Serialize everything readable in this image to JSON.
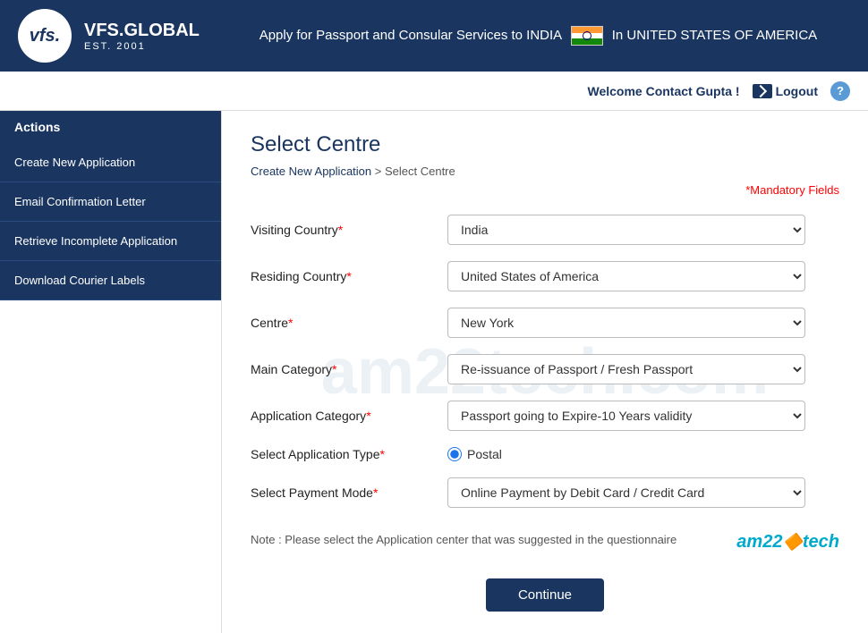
{
  "header": {
    "logo_text": "vfs.",
    "logo_brand": "VFS.GLOBAL",
    "logo_est": "EST. 2001",
    "tagline": "Apply for Passport and Consular Services to INDIA",
    "country": "In UNITED STATES OF AMERICA"
  },
  "topbar": {
    "welcome": "Welcome Contact Gupta !",
    "logout_label": "Logout",
    "help_label": "?"
  },
  "sidebar": {
    "header": "Actions",
    "items": [
      {
        "label": "Create New Application"
      },
      {
        "label": "Email Confirmation Letter"
      },
      {
        "label": "Retrieve Incomplete Application"
      },
      {
        "label": "Download Courier Labels"
      }
    ]
  },
  "page": {
    "title": "Select Centre",
    "breadcrumb_home": "Create New Application",
    "breadcrumb_sep": ">",
    "breadcrumb_current": "Select Centre",
    "mandatory_note": "Mandatory Fields"
  },
  "form": {
    "visiting_country_label": "Visiting Country",
    "visiting_country_value": "India",
    "residing_country_label": "Residing Country",
    "residing_country_value": "United States of America",
    "centre_label": "Centre",
    "centre_value": "New York",
    "main_category_label": "Main Category",
    "main_category_value": "Re-issuance of Passport / Fresh Passport",
    "app_category_label": "Application Category",
    "app_category_value": "Passport going to Expire-10 Years validity",
    "app_type_label": "Select Application Type",
    "app_type_value": "Postal",
    "payment_mode_label": "Select Payment Mode",
    "payment_mode_value": "Online Payment by Debit Card / Credit Card",
    "note": "Note : Please select the Application center that was suggested in the questionnaire",
    "continue_label": "Continue"
  },
  "watermark": "am22tech.com",
  "am22_brand": "am22",
  "am22_dot": "🔶",
  "am22_suffix": "tech"
}
